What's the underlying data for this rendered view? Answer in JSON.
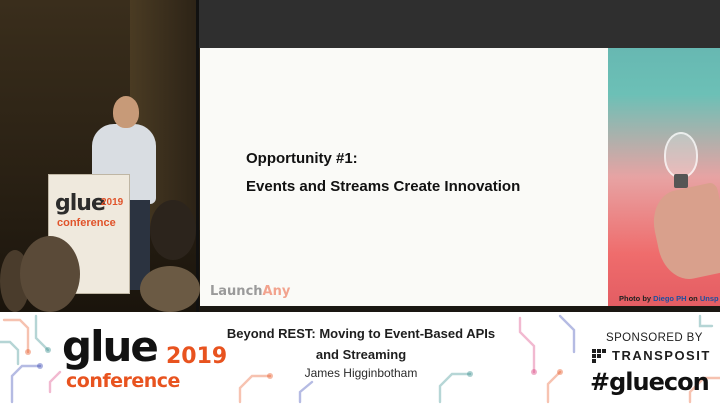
{
  "slide": {
    "title": "Opportunity #1:",
    "subtitle": "Events and Streams Create Innovation",
    "logo_main": "Launch",
    "logo_accent": "Any",
    "photo_credit_prefix": "Photo by ",
    "photo_credit_author": "Diego PH",
    "photo_credit_mid": " on ",
    "photo_credit_site": "Unsp"
  },
  "podium": {
    "brand": "glue",
    "year": "2019",
    "sub": "conference"
  },
  "banner": {
    "brand_word": "glue",
    "brand_year": "2019",
    "brand_sub": "conference",
    "talk_title_line1": "Beyond REST: Moving to Event-Based APIs",
    "talk_title_line2": "and Streaming",
    "speaker": "James Higginbotham",
    "sponsored_by": "SPONSORED BY",
    "sponsor_name": "TRANSPOSIT",
    "hashtag": "#gluecon"
  },
  "colors": {
    "accent_orange": "#e8531f",
    "slide_background": "#fafaf7",
    "banner_background": "#ffffff"
  },
  "icons": [
    "transposit-logo-icon"
  ]
}
